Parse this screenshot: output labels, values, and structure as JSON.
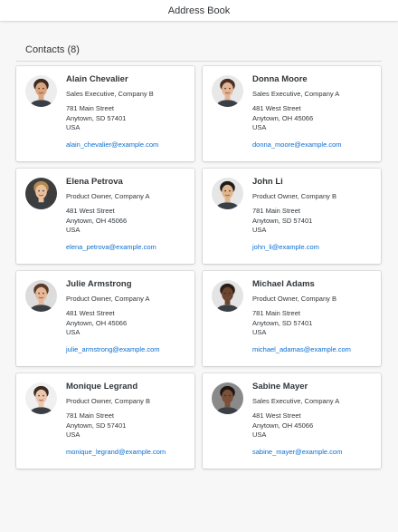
{
  "header": {
    "title": "Address Book"
  },
  "section": {
    "title": "Contacts (8)"
  },
  "contacts": [
    {
      "name": "Alain Chevalier",
      "title": "Sales Executive, Company B",
      "street": "781 Main Street",
      "city": "Anytown, SD 57401",
      "country": "USA",
      "email": "alain_chevalier@example.com",
      "skin": "#d9a47e",
      "hair": "#3b2a20",
      "bg": "#ededed"
    },
    {
      "name": "Donna Moore",
      "title": "Sales Executive, Company A",
      "street": "481 West Street",
      "city": "Anytown, OH 45066",
      "country": "USA",
      "email": "donna_moore@example.com",
      "skin": "#e3b594",
      "hair": "#4a2e22",
      "bg": "#e8e8e8"
    },
    {
      "name": "Elena Petrova",
      "title": "Product Owner, Company A",
      "street": "481 West Street",
      "city": "Anytown, OH 45066",
      "country": "USA",
      "email": "elena_petrova@example.com",
      "skin": "#e9bf9d",
      "hair": "#b08a52",
      "bg": "#3d3d3d"
    },
    {
      "name": "John Li",
      "title": "Product Owner, Company B",
      "street": "781 Main Street",
      "city": "Anytown, SD 57401",
      "country": "USA",
      "email": "john_li@example.com",
      "skin": "#e0b58d",
      "hair": "#1f1a17",
      "bg": "#e6e6e6"
    },
    {
      "name": "Julie Armstrong",
      "title": "Product Owner, Company A",
      "street": "481 West Street",
      "city": "Anytown, OH 45066",
      "country": "USA",
      "email": "julie_armstrong@example.com",
      "skin": "#e6b897",
      "hair": "#5a3a28",
      "bg": "#dcdcdc"
    },
    {
      "name": "Michael Adams",
      "title": "Product Owner, Company B",
      "street": "781 Main Street",
      "city": "Anytown, SD 57401",
      "country": "USA",
      "email": "michael_adamas@example.com",
      "skin": "#6b4530",
      "hair": "#2a1c16",
      "bg": "#e4e4e4"
    },
    {
      "name": "Monique Legrand",
      "title": "Product Owner, Company B",
      "street": "781 Main Street",
      "city": "Anytown, SD 57401",
      "country": "USA",
      "email": "monique_legrand@example.com",
      "skin": "#ecc6ad",
      "hair": "#3a2a22",
      "bg": "#f0f0f0"
    },
    {
      "name": "Sabine Mayer",
      "title": "Sales Executive, Company A",
      "street": "481 West Street",
      "city": "Anytown, OH 45066",
      "country": "USA",
      "email": "sabine_mayer@example.com",
      "skin": "#7a5038",
      "hair": "#1e1512",
      "bg": "#8a8a8a"
    }
  ]
}
